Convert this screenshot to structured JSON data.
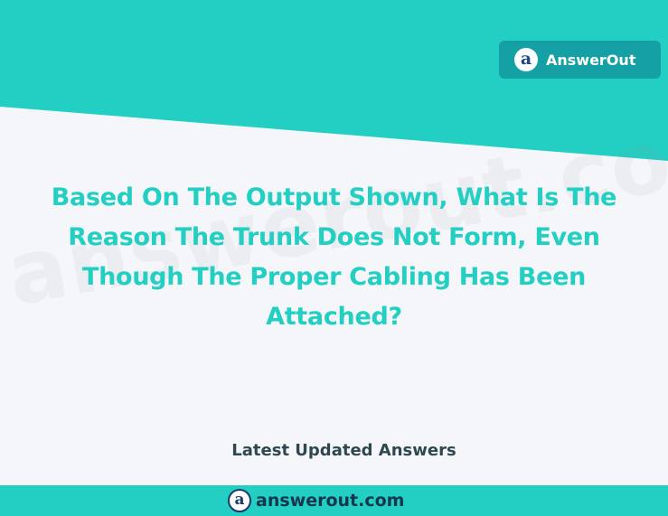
{
  "brand": {
    "badge_label": "AnswerOut",
    "icon_glyph": "a",
    "color": "#22cfc2"
  },
  "watermark": {
    "text": "answerout.com"
  },
  "headline": {
    "lines": [
      "Based On The Output Shown, What Is The",
      "Reason The Trunk Does Not Form, Even",
      "Though The Proper Cabling Has Been",
      "Attached?"
    ]
  },
  "subtitle": "Latest Updated Answers",
  "footer": {
    "domain": "answerout.com",
    "icon_glyph": "a"
  }
}
